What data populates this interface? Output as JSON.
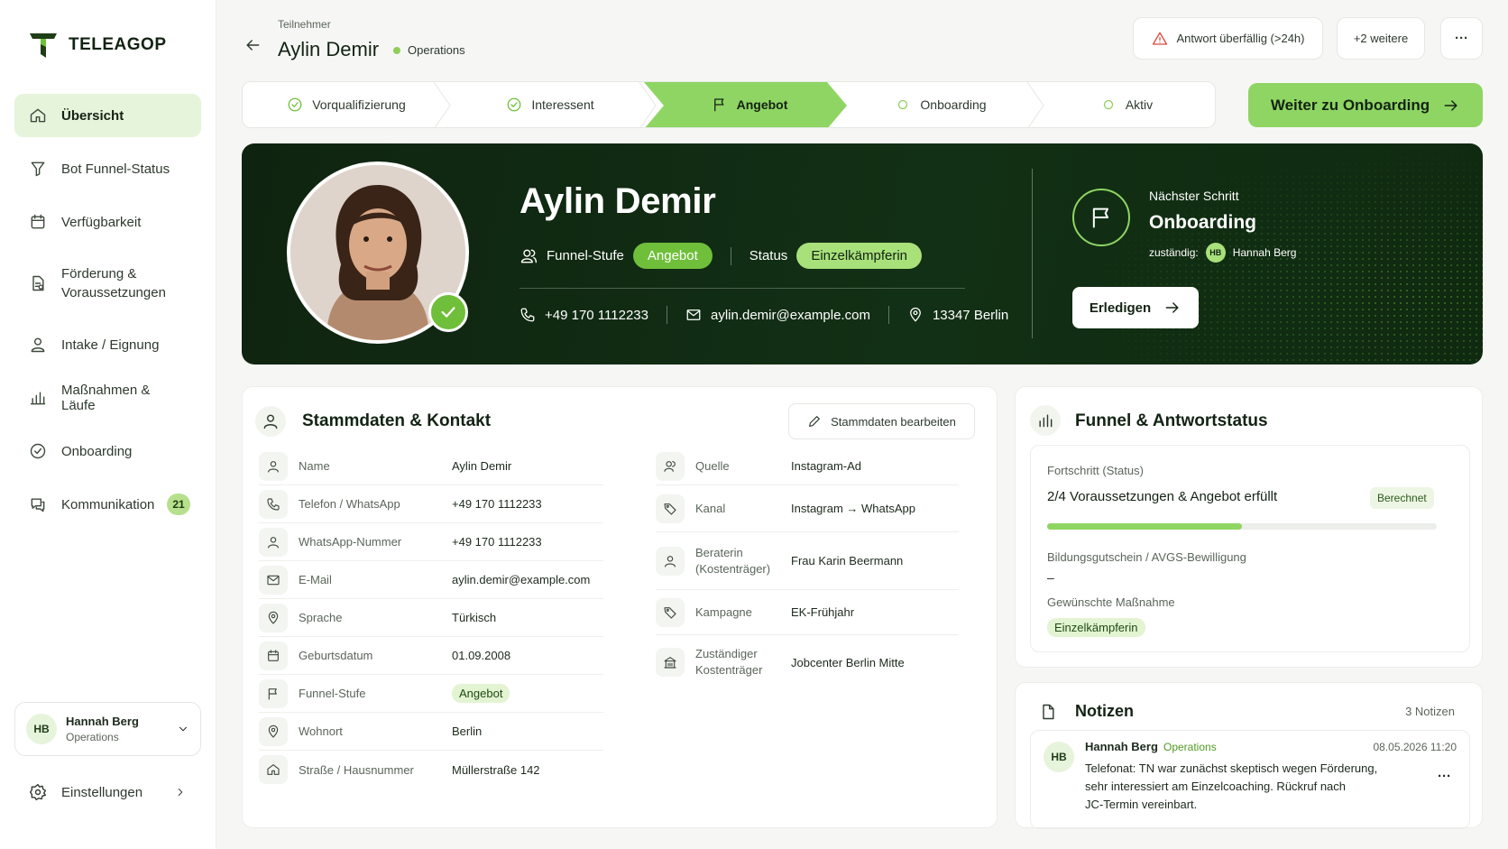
{
  "app": {
    "name": "TELEAGOP"
  },
  "sidebar": {
    "items": [
      {
        "label": "Übersicht",
        "icon": "home-icon"
      },
      {
        "label": "Bot Funnel-Status",
        "icon": "filter-icon"
      },
      {
        "label": "Verfügbarkeit",
        "icon": "calendar-icon"
      },
      {
        "label": "Förderung &\nVoraussetzungen",
        "icon": "document-icon"
      },
      {
        "label": "Intake / Eignung",
        "icon": "user-icon"
      },
      {
        "label": "Maßnahmen & Läufe",
        "icon": "bar-chart-icon"
      },
      {
        "label": "Onboarding",
        "icon": "check-circle-icon"
      },
      {
        "label": "Kommunikation",
        "icon": "chat-icon",
        "badge": "21"
      }
    ],
    "user": {
      "initials": "HB",
      "name": "Hannah Berg",
      "role": "Operations"
    },
    "settings_label": "Einstellungen"
  },
  "header": {
    "breadcrumb": "Teilnehmer",
    "title": "Aylin Demir",
    "department": "Operations",
    "alert_label": "Antwort überfällig (>24h)",
    "more_label": "+2 weitere",
    "menu_label": "···"
  },
  "stepper": {
    "steps": [
      {
        "label": "Vorqualifizierung",
        "state": "done"
      },
      {
        "label": "Interessent",
        "state": "done"
      },
      {
        "label": "Angebot",
        "state": "active"
      },
      {
        "label": "Onboarding",
        "state": "todo"
      },
      {
        "label": "Aktiv",
        "state": "todo"
      }
    ],
    "cta_label": "Weiter zu Onboarding"
  },
  "hero": {
    "name": "Aylin Demir",
    "funnel_label": "Funnel-Stufe",
    "funnel_value": "Angebot",
    "status_label": "Status",
    "status_value": "Einzelkämpferin",
    "phone": "+49 170 1112233",
    "email": "aylin.demir@example.com",
    "location": "13347 Berlin",
    "next_step_label": "Nächster Schritt",
    "next_step_value": "Onboarding",
    "responsible_label": "zuständig:",
    "responsible_initials": "HB",
    "responsible_name": "Hannah Berg",
    "done_label": "Erledigen"
  },
  "stammdaten": {
    "title": "Stammdaten & Kontakt",
    "edit_label": "Stammdaten bearbeiten",
    "fields": [
      {
        "label": "Name",
        "value": "Aylin Demir"
      },
      {
        "label": "Telefon / WhatsApp",
        "value": "+49 170 1112233"
      },
      {
        "label": "WhatsApp-Nummer",
        "value": "+49 170 1112233"
      },
      {
        "label": "E-Mail",
        "value": "aylin.demir@example.com"
      },
      {
        "label": "Sprache",
        "value": "Türkisch"
      },
      {
        "label": "Geburtsdatum",
        "value": "01.09.2008"
      },
      {
        "label": "Funnel-Stufe",
        "value": "Angebot"
      },
      {
        "label": "Wohnort",
        "value": "Berlin"
      },
      {
        "label": "Straße / Hausnummer",
        "value": "Müllerstraße 142"
      }
    ],
    "fields_right": [
      {
        "label": "Quelle",
        "value": "Instagram-Ad"
      },
      {
        "label": "Kanal",
        "value": "Instagram → WhatsApp"
      },
      {
        "label": "Beraterin\n(Kostenträger)",
        "value": "Frau Karin Beermann"
      },
      {
        "label": "Kampagne",
        "value": "EK-Frühjahr"
      },
      {
        "label": "Zuständiger\nKostenträger",
        "value": "Jobcenter Berlin Mitte"
      }
    ]
  },
  "funnel": {
    "title": "Funnel & Antwortstatus",
    "progress_label": "Fortschritt (Status)",
    "progress_text": "2/4 Voraussetzungen & Angebot erfüllt",
    "progress_tag": "Berechnet",
    "progress_fraction": 0.5,
    "voucher_label": "Bildungsgutschein / AVGS-Bewilligung",
    "voucher_value": "–",
    "measure_label": "Gewünschte Maßnahme",
    "measure_value": "Einzelkämpferin"
  },
  "notes": {
    "title": "Notizen",
    "count": "3 Notizen",
    "items": [
      {
        "initials": "HB",
        "author": "Hannah Berg",
        "team": "Operations",
        "date": "08.05.2026 11:20",
        "line1": "Telefonat: TN war zunächst skeptisch wegen Förderung,",
        "line2": "sehr interessiert am Einzelcoaching. Rückruf nach",
        "line3": "JC-Termin vereinbart.",
        "menu": "···"
      }
    ]
  },
  "colors": {
    "accent": "#8fd563",
    "dark": "#0f2410",
    "alert": "#d9493c"
  }
}
